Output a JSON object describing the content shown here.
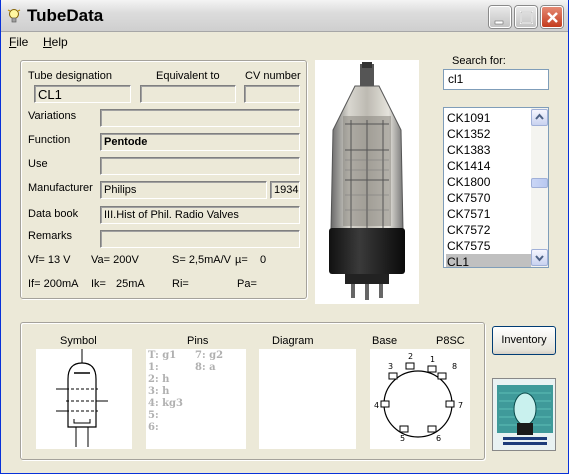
{
  "window": {
    "title": "TubeData"
  },
  "menu": {
    "file": "File",
    "help": "Help"
  },
  "tube": {
    "designation_label": "Tube designation",
    "equivalent_label": "Equivalent to",
    "cv_label": "CV number",
    "designation": "CL1",
    "equivalent": "",
    "cv_number": "",
    "variations_label": "Variations",
    "variations": "",
    "function_label": "Function",
    "function": "Pentode",
    "use_label": "Use",
    "use": "",
    "manufacturer_label": "Manufacturer",
    "manufacturer": "Philips",
    "year": "1934",
    "databook_label": "Data book",
    "databook": "III.Hist of Phil. Radio Valves",
    "remarks_label": "Remarks",
    "remarks": ""
  },
  "specs": {
    "vf": "Vf= 13 V",
    "va": "Va= 200V",
    "s": "S= 2,5mA/V",
    "mu": "µ=",
    "mu_val": "0",
    "if": "If= 200mA",
    "ik": "Ik=",
    "ik_val": "25mA",
    "ri": "Ri=",
    "pa": "Pa="
  },
  "search": {
    "label": "Search for:",
    "value": "cl1",
    "items": [
      "CK1091",
      "CK1352",
      "CK1383",
      "CK1414",
      "CK1800",
      "CK7570",
      "CK7571",
      "CK7572",
      "CK7575",
      "CL1"
    ],
    "selected": "CL1"
  },
  "bottom": {
    "symbol_label": "Symbol",
    "pins_label": "Pins",
    "diagram_label": "Diagram",
    "base_label": "Base",
    "base_type": "P8SC",
    "pins_col1": [
      "T: g1",
      "1:",
      "2: h",
      "3: h",
      "4: kg3",
      "5:",
      "6:"
    ],
    "pins_col2": [
      "7: g2",
      "8: a"
    ],
    "base_pins": [
      "1",
      "2",
      "3",
      "4",
      "5",
      "6",
      "7",
      "8"
    ]
  },
  "buttons": {
    "inventory": "Inventory"
  },
  "icons": {
    "app": "lightbulb-icon",
    "minimize": "minimize-icon",
    "maximize": "maximize-icon",
    "close": "close-icon"
  }
}
